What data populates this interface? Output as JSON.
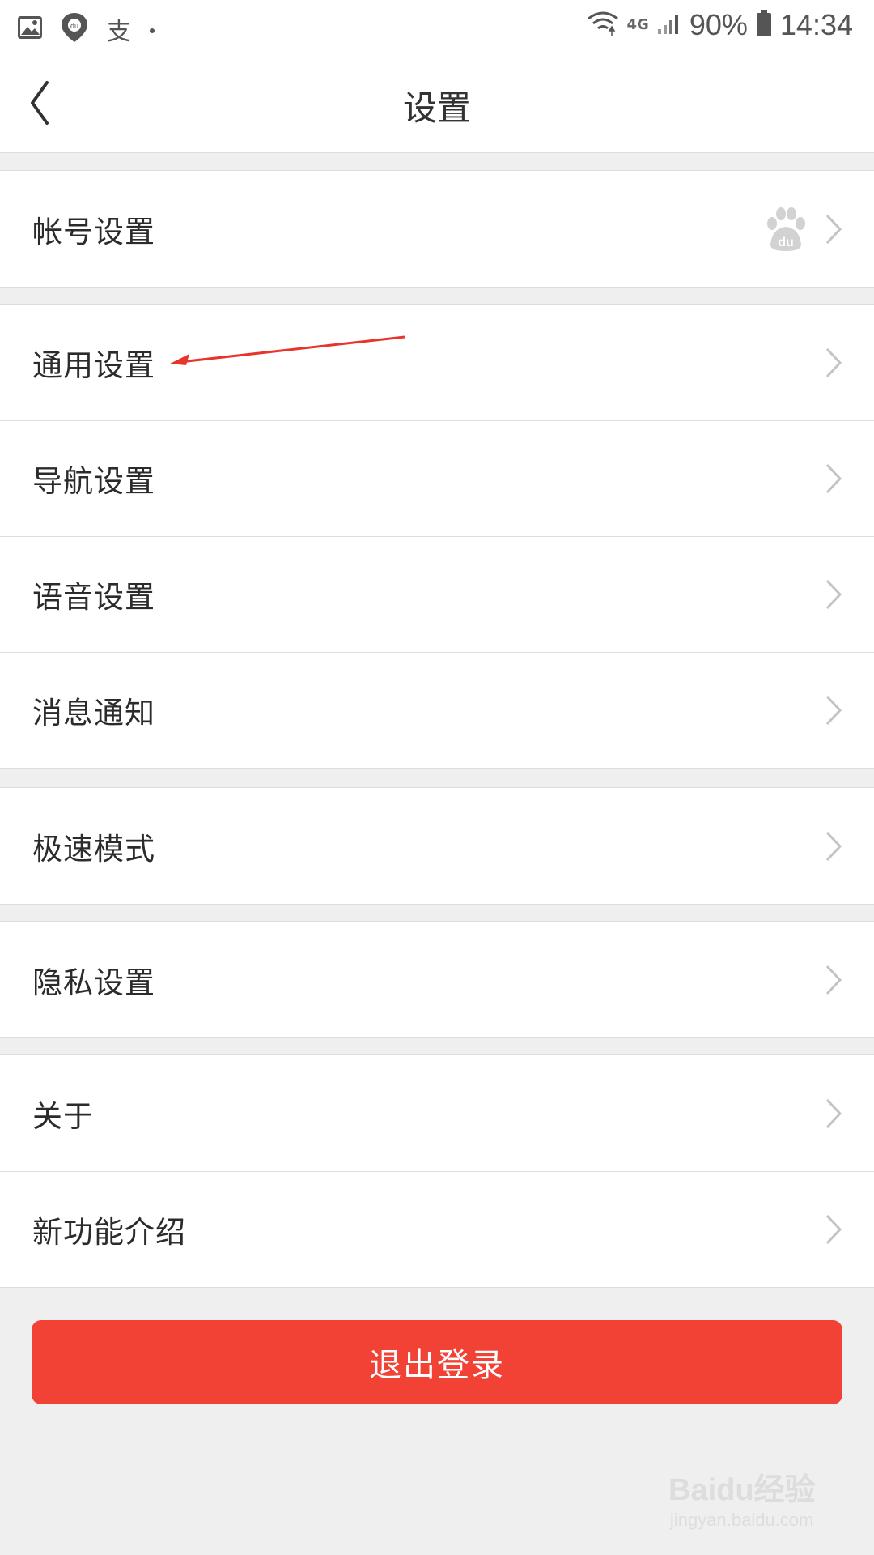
{
  "status_bar": {
    "network": "4G",
    "battery": "90%",
    "time": "14:34",
    "notification_char": "支",
    "icons": [
      "gallery-icon",
      "baidu-map-icon",
      "alipay-icon",
      "wifi-icon",
      "signal-icon",
      "battery-icon"
    ]
  },
  "nav": {
    "title": "设置",
    "back_icon": "chevron-left-icon"
  },
  "groups": [
    {
      "items": [
        {
          "label": "帐号设置",
          "avatar": "baidu-paw-icon"
        }
      ]
    },
    {
      "items": [
        {
          "label": "通用设置"
        },
        {
          "label": "导航设置"
        },
        {
          "label": "语音设置"
        },
        {
          "label": "消息通知"
        }
      ]
    },
    {
      "items": [
        {
          "label": "极速模式"
        }
      ]
    },
    {
      "items": [
        {
          "label": "隐私设置"
        }
      ]
    },
    {
      "items": [
        {
          "label": "关于"
        },
        {
          "label": "新功能介绍"
        }
      ]
    }
  ],
  "logout": {
    "label": "退出登录"
  },
  "watermark": {
    "brand": "Baidu经验",
    "url": "jingyan.baidu.com"
  },
  "colors": {
    "accent": "#f24236",
    "background": "#efefef",
    "annotation_arrow": "#e8352b"
  }
}
